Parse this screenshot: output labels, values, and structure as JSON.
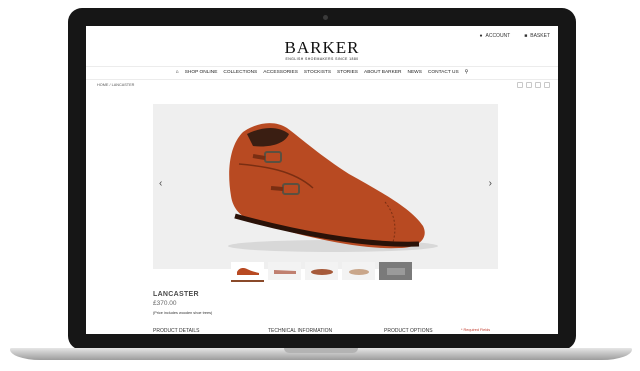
{
  "header": {
    "account_label": "ACCOUNT",
    "basket_label": "BASKET",
    "logo": "BARKER",
    "tagline": "ENGLISH SHOEMAKERS SINCE 1880"
  },
  "nav": {
    "items": [
      "SHOP ONLINE",
      "COLLECTIONS",
      "ACCESSORIES",
      "STOCKISTS",
      "STORIES",
      "ABOUT BARKER",
      "NEWS",
      "CONTACT US"
    ]
  },
  "breadcrumb": {
    "home": "HOME",
    "separator": "/",
    "current": "LANCASTER"
  },
  "product": {
    "name": "LANCASTER",
    "price": "£370.00",
    "price_note": "(Price includes wooden shoe trees)",
    "sections": [
      "PRODUCT DETAILS",
      "TECHNICAL INFORMATION",
      "PRODUCT OPTIONS"
    ],
    "required_note": "* Required Fields"
  },
  "icons": [
    "home-icon",
    "search-icon",
    "user-icon",
    "basket-icon",
    "chevron-left-icon",
    "chevron-right-icon"
  ],
  "colors": {
    "leather": "#b84a22",
    "accent": "#8a4a2a",
    "required": "#c0392b"
  }
}
